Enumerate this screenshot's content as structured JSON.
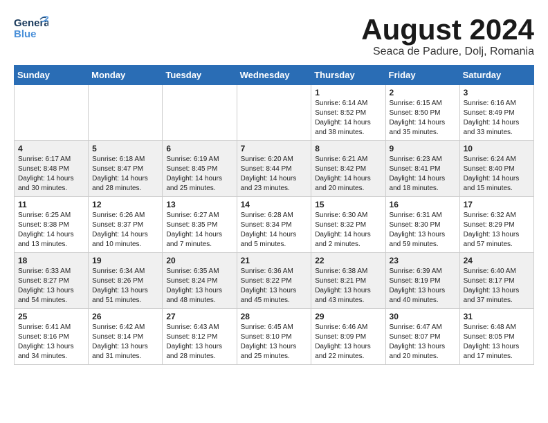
{
  "header": {
    "logo_general": "General",
    "logo_blue": "Blue",
    "month_title": "August 2024",
    "subtitle": "Seaca de Padure, Dolj, Romania"
  },
  "weekdays": [
    "Sunday",
    "Monday",
    "Tuesday",
    "Wednesday",
    "Thursday",
    "Friday",
    "Saturday"
  ],
  "weeks": [
    [
      {
        "day": "",
        "sunrise": "",
        "sunset": "",
        "daylight": ""
      },
      {
        "day": "",
        "sunrise": "",
        "sunset": "",
        "daylight": ""
      },
      {
        "day": "",
        "sunrise": "",
        "sunset": "",
        "daylight": ""
      },
      {
        "day": "",
        "sunrise": "",
        "sunset": "",
        "daylight": ""
      },
      {
        "day": "1",
        "sunrise": "Sunrise: 6:14 AM",
        "sunset": "Sunset: 8:52 PM",
        "daylight": "Daylight: 14 hours and 38 minutes."
      },
      {
        "day": "2",
        "sunrise": "Sunrise: 6:15 AM",
        "sunset": "Sunset: 8:50 PM",
        "daylight": "Daylight: 14 hours and 35 minutes."
      },
      {
        "day": "3",
        "sunrise": "Sunrise: 6:16 AM",
        "sunset": "Sunset: 8:49 PM",
        "daylight": "Daylight: 14 hours and 33 minutes."
      }
    ],
    [
      {
        "day": "4",
        "sunrise": "Sunrise: 6:17 AM",
        "sunset": "Sunset: 8:48 PM",
        "daylight": "Daylight: 14 hours and 30 minutes."
      },
      {
        "day": "5",
        "sunrise": "Sunrise: 6:18 AM",
        "sunset": "Sunset: 8:47 PM",
        "daylight": "Daylight: 14 hours and 28 minutes."
      },
      {
        "day": "6",
        "sunrise": "Sunrise: 6:19 AM",
        "sunset": "Sunset: 8:45 PM",
        "daylight": "Daylight: 14 hours and 25 minutes."
      },
      {
        "day": "7",
        "sunrise": "Sunrise: 6:20 AM",
        "sunset": "Sunset: 8:44 PM",
        "daylight": "Daylight: 14 hours and 23 minutes."
      },
      {
        "day": "8",
        "sunrise": "Sunrise: 6:21 AM",
        "sunset": "Sunset: 8:42 PM",
        "daylight": "Daylight: 14 hours and 20 minutes."
      },
      {
        "day": "9",
        "sunrise": "Sunrise: 6:23 AM",
        "sunset": "Sunset: 8:41 PM",
        "daylight": "Daylight: 14 hours and 18 minutes."
      },
      {
        "day": "10",
        "sunrise": "Sunrise: 6:24 AM",
        "sunset": "Sunset: 8:40 PM",
        "daylight": "Daylight: 14 hours and 15 minutes."
      }
    ],
    [
      {
        "day": "11",
        "sunrise": "Sunrise: 6:25 AM",
        "sunset": "Sunset: 8:38 PM",
        "daylight": "Daylight: 14 hours and 13 minutes."
      },
      {
        "day": "12",
        "sunrise": "Sunrise: 6:26 AM",
        "sunset": "Sunset: 8:37 PM",
        "daylight": "Daylight: 14 hours and 10 minutes."
      },
      {
        "day": "13",
        "sunrise": "Sunrise: 6:27 AM",
        "sunset": "Sunset: 8:35 PM",
        "daylight": "Daylight: 14 hours and 7 minutes."
      },
      {
        "day": "14",
        "sunrise": "Sunrise: 6:28 AM",
        "sunset": "Sunset: 8:34 PM",
        "daylight": "Daylight: 14 hours and 5 minutes."
      },
      {
        "day": "15",
        "sunrise": "Sunrise: 6:30 AM",
        "sunset": "Sunset: 8:32 PM",
        "daylight": "Daylight: 14 hours and 2 minutes."
      },
      {
        "day": "16",
        "sunrise": "Sunrise: 6:31 AM",
        "sunset": "Sunset: 8:30 PM",
        "daylight": "Daylight: 13 hours and 59 minutes."
      },
      {
        "day": "17",
        "sunrise": "Sunrise: 6:32 AM",
        "sunset": "Sunset: 8:29 PM",
        "daylight": "Daylight: 13 hours and 57 minutes."
      }
    ],
    [
      {
        "day": "18",
        "sunrise": "Sunrise: 6:33 AM",
        "sunset": "Sunset: 8:27 PM",
        "daylight": "Daylight: 13 hours and 54 minutes."
      },
      {
        "day": "19",
        "sunrise": "Sunrise: 6:34 AM",
        "sunset": "Sunset: 8:26 PM",
        "daylight": "Daylight: 13 hours and 51 minutes."
      },
      {
        "day": "20",
        "sunrise": "Sunrise: 6:35 AM",
        "sunset": "Sunset: 8:24 PM",
        "daylight": "Daylight: 13 hours and 48 minutes."
      },
      {
        "day": "21",
        "sunrise": "Sunrise: 6:36 AM",
        "sunset": "Sunset: 8:22 PM",
        "daylight": "Daylight: 13 hours and 45 minutes."
      },
      {
        "day": "22",
        "sunrise": "Sunrise: 6:38 AM",
        "sunset": "Sunset: 8:21 PM",
        "daylight": "Daylight: 13 hours and 43 minutes."
      },
      {
        "day": "23",
        "sunrise": "Sunrise: 6:39 AM",
        "sunset": "Sunset: 8:19 PM",
        "daylight": "Daylight: 13 hours and 40 minutes."
      },
      {
        "day": "24",
        "sunrise": "Sunrise: 6:40 AM",
        "sunset": "Sunset: 8:17 PM",
        "daylight": "Daylight: 13 hours and 37 minutes."
      }
    ],
    [
      {
        "day": "25",
        "sunrise": "Sunrise: 6:41 AM",
        "sunset": "Sunset: 8:16 PM",
        "daylight": "Daylight: 13 hours and 34 minutes."
      },
      {
        "day": "26",
        "sunrise": "Sunrise: 6:42 AM",
        "sunset": "Sunset: 8:14 PM",
        "daylight": "Daylight: 13 hours and 31 minutes."
      },
      {
        "day": "27",
        "sunrise": "Sunrise: 6:43 AM",
        "sunset": "Sunset: 8:12 PM",
        "daylight": "Daylight: 13 hours and 28 minutes."
      },
      {
        "day": "28",
        "sunrise": "Sunrise: 6:45 AM",
        "sunset": "Sunset: 8:10 PM",
        "daylight": "Daylight: 13 hours and 25 minutes."
      },
      {
        "day": "29",
        "sunrise": "Sunrise: 6:46 AM",
        "sunset": "Sunset: 8:09 PM",
        "daylight": "Daylight: 13 hours and 22 minutes."
      },
      {
        "day": "30",
        "sunrise": "Sunrise: 6:47 AM",
        "sunset": "Sunset: 8:07 PM",
        "daylight": "Daylight: 13 hours and 20 minutes."
      },
      {
        "day": "31",
        "sunrise": "Sunrise: 6:48 AM",
        "sunset": "Sunset: 8:05 PM",
        "daylight": "Daylight: 13 hours and 17 minutes."
      }
    ]
  ]
}
